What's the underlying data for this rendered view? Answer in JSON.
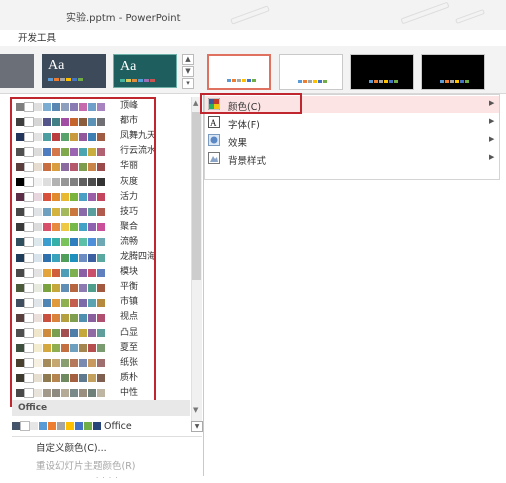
{
  "window": {
    "title": "实验.pptm - PowerPoint"
  },
  "ribbon": {
    "tab_label": "开发工具",
    "theme_thumbs": [
      {
        "text": "Aa",
        "bg": "#3c4a5a"
      },
      {
        "text": "Aa",
        "bg": "#1f5e5e"
      }
    ]
  },
  "color_schemes": [
    {
      "name": "顶峰",
      "colors": [
        "#7f7f7f",
        "#ffffff",
        "#dfdfdf",
        "#7badd3",
        "#5a87b1",
        "#8d9fbd",
        "#8a7cb3",
        "#c66aad",
        "#6fa0c9",
        "#a783c0"
      ]
    },
    {
      "name": "都市",
      "colors": [
        "#3f3f3f",
        "#ffffff",
        "#d6d6d6",
        "#53548a",
        "#438086",
        "#a04da3",
        "#c4652d",
        "#8b5d3d",
        "#5c92b5",
        "#6f6f74"
      ]
    },
    {
      "name": "凤舞九天",
      "colors": [
        "#24355c",
        "#ffffff",
        "#e3e3e3",
        "#4c9fa0",
        "#bb3f3f",
        "#58a26b",
        "#c99a3e",
        "#93589b",
        "#3e7fb3",
        "#a05c43"
      ]
    },
    {
      "name": "行云流水",
      "colors": [
        "#505050",
        "#ffffff",
        "#dcdcdc",
        "#4e7cc0",
        "#d4774a",
        "#7fa94b",
        "#9b65b1",
        "#4aa5b0",
        "#c9ad3e",
        "#b06272"
      ]
    },
    {
      "name": "华丽",
      "colors": [
        "#5a3e3e",
        "#ffffff",
        "#e6dcd0",
        "#c76d3f",
        "#d99c3e",
        "#8b6a9f",
        "#b5586c",
        "#7d9c4d",
        "#c9844a",
        "#9a4a4a"
      ]
    },
    {
      "name": "灰度",
      "colors": [
        "#000000",
        "#ffffff",
        "#f2f2f2",
        "#dddddd",
        "#b2b2b2",
        "#969696",
        "#808080",
        "#5f5f5f",
        "#4d4d4d",
        "#333333"
      ]
    },
    {
      "name": "活力",
      "colors": [
        "#5b2d47",
        "#ffffff",
        "#e7d6de",
        "#d8503b",
        "#e0892d",
        "#e7b830",
        "#7bb33f",
        "#4a9fc4",
        "#9b5fa8",
        "#c4465e"
      ]
    },
    {
      "name": "技巧",
      "colors": [
        "#474747",
        "#ffffff",
        "#dfe3e5",
        "#6fa0c0",
        "#d4b33f",
        "#a3b95c",
        "#c9763f",
        "#8a6aa8",
        "#5b9e9e",
        "#b05b4d"
      ]
    },
    {
      "name": "聚合",
      "colors": [
        "#3a3a3a",
        "#ffffff",
        "#dcdcdc",
        "#d84f6a",
        "#e68a3f",
        "#eec843",
        "#76b84a",
        "#43a3c7",
        "#8f62b0",
        "#c94f9a"
      ]
    },
    {
      "name": "流畅",
      "colors": [
        "#2f4f5f",
        "#ffffff",
        "#dde8ec",
        "#3b9ecf",
        "#35b0a8",
        "#7ac35a",
        "#2f7fbf",
        "#5cbfa8",
        "#4f8fd9",
        "#6ea8b5"
      ]
    },
    {
      "name": "龙腾四海",
      "colors": [
        "#1f3d5a",
        "#ffffff",
        "#d9e3ec",
        "#2e6fae",
        "#39a3bb",
        "#4f9e5a",
        "#1f8fbd",
        "#6d8dc2",
        "#3b5fa0",
        "#5aa9a0"
      ]
    },
    {
      "name": "模块",
      "colors": [
        "#4a4a4a",
        "#ffffff",
        "#e3e3e3",
        "#e2a43b",
        "#d0603b",
        "#4f9eb8",
        "#7fb04f",
        "#8a5fa3",
        "#c94f6a",
        "#5f7fbf"
      ]
    },
    {
      "name": "平衡",
      "colors": [
        "#4a5a3a",
        "#ffffff",
        "#e6eadf",
        "#7aa33f",
        "#c4a83b",
        "#5f8fb5",
        "#b5653f",
        "#8d7ab0",
        "#4f9e8c",
        "#a3593f"
      ]
    },
    {
      "name": "市镇",
      "colors": [
        "#3f4f5f",
        "#ffffff",
        "#e0e5ea",
        "#4f85b5",
        "#e09a3b",
        "#8fb04f",
        "#c45f4f",
        "#7d6aa8",
        "#5aa3b0",
        "#b58a3f"
      ]
    },
    {
      "name": "视点",
      "colors": [
        "#5a3f3f",
        "#ffffff",
        "#eadfda",
        "#c94f3f",
        "#d9823b",
        "#b5a03f",
        "#7f9e4f",
        "#4f8fb0",
        "#8a5f9e",
        "#b04f6f"
      ]
    },
    {
      "name": "凸显",
      "colors": [
        "#4f4f4f",
        "#ffffff",
        "#f0e6cc",
        "#cf8a3b",
        "#7a9f4f",
        "#a34f4f",
        "#4f7fa8",
        "#c4a83b",
        "#8f6aa3",
        "#5f9e9a"
      ]
    },
    {
      "name": "夏至",
      "colors": [
        "#3f4f3f",
        "#ffffff",
        "#f3eccf",
        "#d4a83f",
        "#8fae4f",
        "#c46f3f",
        "#6f9fbf",
        "#a5854f",
        "#b54f4f",
        "#7a9a6f"
      ]
    },
    {
      "name": "纸张",
      "colors": [
        "#4a4030",
        "#ffffff",
        "#f5f0df",
        "#a58a5a",
        "#c4a86f",
        "#8a9f6f",
        "#b5785a",
        "#7a8ab0",
        "#c99a5f",
        "#9f6f6f"
      ]
    },
    {
      "name": "质朴",
      "colors": [
        "#3f3a2f",
        "#ffffff",
        "#e6dfcf",
        "#8f7a4f",
        "#b5854f",
        "#6f8a5f",
        "#a35f3f",
        "#5f7a8f",
        "#c4a05f",
        "#7f5f4f"
      ]
    },
    {
      "name": "中性",
      "colors": [
        "#4a4a4a",
        "#ffffff",
        "#e8e4dc",
        "#a3998a",
        "#8f8a7f",
        "#b5aa95",
        "#7a8a8a",
        "#9a8f7f",
        "#6f7f7a",
        "#bfb5a3"
      ]
    }
  ],
  "office_section": {
    "header": "Office",
    "name": "Office",
    "colors": [
      "#44546a",
      "#ffffff",
      "#e7e6e6",
      "#5b9bd5",
      "#ed7d31",
      "#a5a5a5",
      "#ffc000",
      "#4472c4",
      "#70ad47",
      "#264478"
    ]
  },
  "panel_actions": {
    "custom_colors": "自定义颜色(C)...",
    "reset_colors": "重设幻灯片主题颜色(R)"
  },
  "menu": {
    "items": [
      {
        "label": "颜色(C)",
        "icon": "color-swatch-icon",
        "highlighted": true
      },
      {
        "label": "字体(F)",
        "icon": "font-icon",
        "highlighted": false
      },
      {
        "label": "效果",
        "icon": "effects-icon",
        "highlighted": false
      },
      {
        "label": "背景样式",
        "icon": "background-style-icon",
        "highlighted": false
      }
    ]
  },
  "colors": {
    "accent_red": "#c0262e",
    "highlight": "#fde4e4"
  }
}
